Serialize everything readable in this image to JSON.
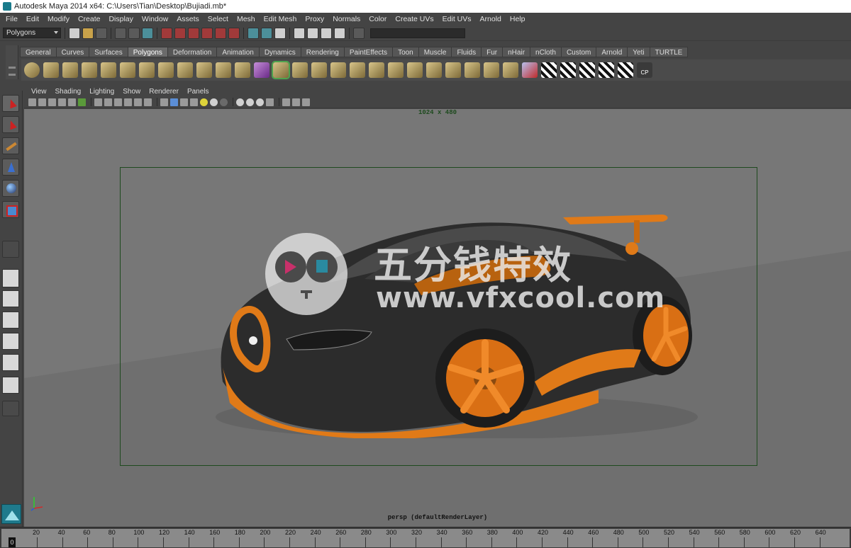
{
  "window": {
    "title": "Autodesk Maya 2014 x64: C:\\Users\\Tian\\Desktop\\Bujiadi.mb*"
  },
  "menubar": [
    "File",
    "Edit",
    "Modify",
    "Create",
    "Display",
    "Window",
    "Assets",
    "Select",
    "Mesh",
    "Edit Mesh",
    "Proxy",
    "Normals",
    "Color",
    "Create UVs",
    "Edit UVs",
    "Arnold",
    "Help"
  ],
  "statusline": {
    "mode": "Polygons"
  },
  "shelf": {
    "tabs": [
      "General",
      "Curves",
      "Surfaces",
      "Polygons",
      "Deformation",
      "Animation",
      "Dynamics",
      "Rendering",
      "PaintEffects",
      "Toon",
      "Muscle",
      "Fluids",
      "Fur",
      "nHair",
      "nCloth",
      "Custom",
      "Arnold",
      "Yeti",
      "TURTLE"
    ],
    "active_tab": "Polygons",
    "cp_label": "CP"
  },
  "panel": {
    "menus": [
      "View",
      "Shading",
      "Lighting",
      "Show",
      "Renderer",
      "Panels"
    ],
    "resolution": "1024 x 480",
    "camera_label": "persp (defaultRenderLayer)"
  },
  "watermark": {
    "title": "五分钱特效",
    "url": "www.vfxcool.com"
  },
  "timeslider": {
    "current_frame": "0",
    "ticks": [
      "20",
      "40",
      "60",
      "80",
      "100",
      "120",
      "140",
      "160",
      "180",
      "200",
      "220",
      "240",
      "260",
      "280",
      "300",
      "320",
      "340",
      "360",
      "380",
      "400",
      "420",
      "440",
      "460",
      "480",
      "500",
      "520",
      "540",
      "560",
      "580",
      "600",
      "620",
      "640"
    ]
  },
  "colors": {
    "car_body": "#2c2c2c",
    "car_accent": "#e07a18",
    "viewport_bg": "#737373",
    "gate": "#1e4a1e"
  }
}
